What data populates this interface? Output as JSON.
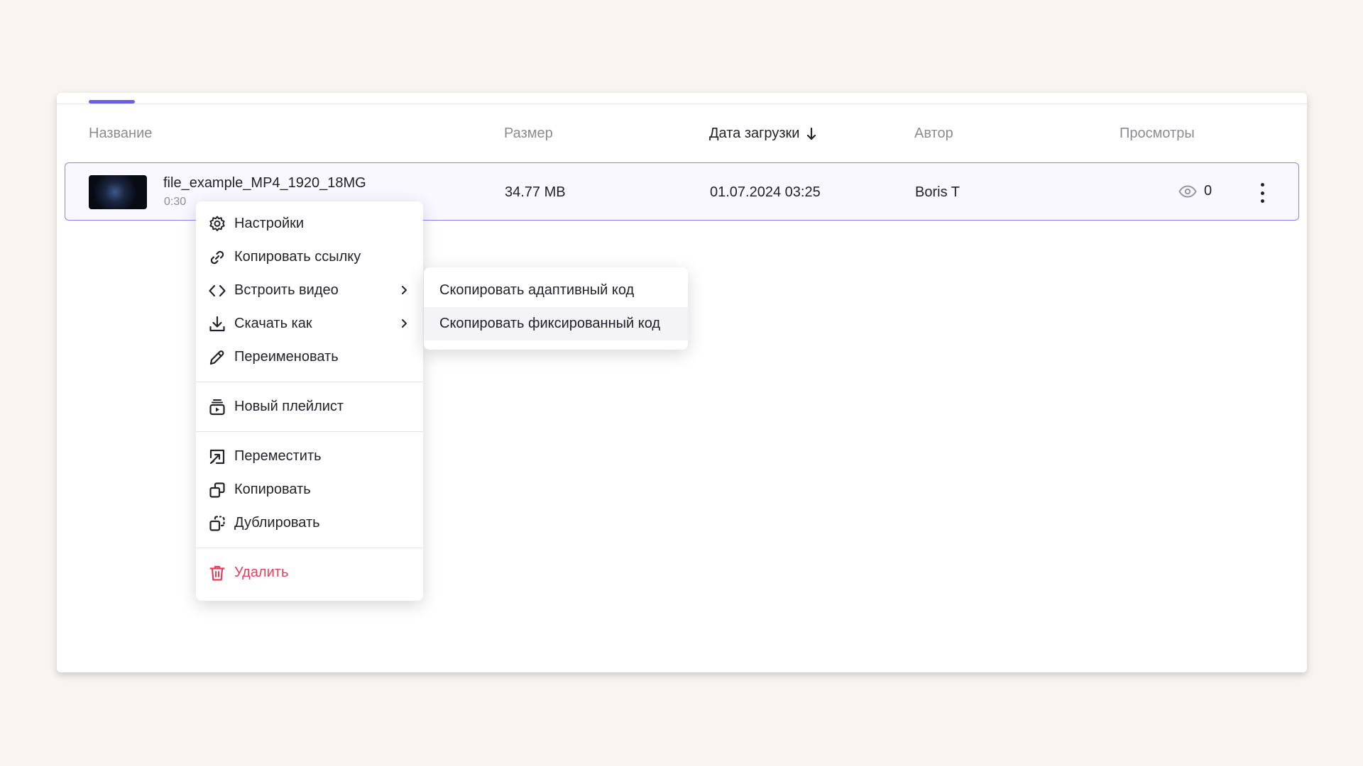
{
  "table": {
    "columns": {
      "name": "Название",
      "size": "Размер",
      "date": "Дата загрузки",
      "author": "Автор",
      "views": "Просмотры"
    },
    "sort_icon": "arrow-down-icon",
    "rows": [
      {
        "name": "file_example_MP4_1920_18MG",
        "duration": "0:30",
        "size": "34.77 MB",
        "date": "01.07.2024 03:25",
        "author": "Boris T",
        "views": "0"
      }
    ]
  },
  "context_menu": {
    "items": [
      {
        "label": "Настройки",
        "icon": "gear-icon"
      },
      {
        "label": "Копировать ссылку",
        "icon": "link-icon"
      },
      {
        "label": "Встроить видео",
        "icon": "code-icon",
        "submenu": true
      },
      {
        "label": "Скачать как",
        "icon": "download-icon",
        "submenu": true
      },
      {
        "label": "Переименовать",
        "icon": "pencil-icon"
      },
      {
        "label": "Новый плейлист",
        "icon": "playlist-icon"
      },
      {
        "label": "Переместить",
        "icon": "move-icon"
      },
      {
        "label": "Копировать",
        "icon": "copy-icon"
      },
      {
        "label": "Дублировать",
        "icon": "duplicate-icon"
      },
      {
        "label": "Удалить",
        "icon": "trash-icon"
      }
    ]
  },
  "embed_submenu": {
    "items": [
      {
        "label": "Скопировать адаптивный код"
      },
      {
        "label": "Скопировать фиксированный код"
      }
    ]
  },
  "colors": {
    "accent": "#6b5cf0",
    "row_border": "#8e82f1",
    "danger": "#e83e5b",
    "background": "#f7f4f2"
  }
}
